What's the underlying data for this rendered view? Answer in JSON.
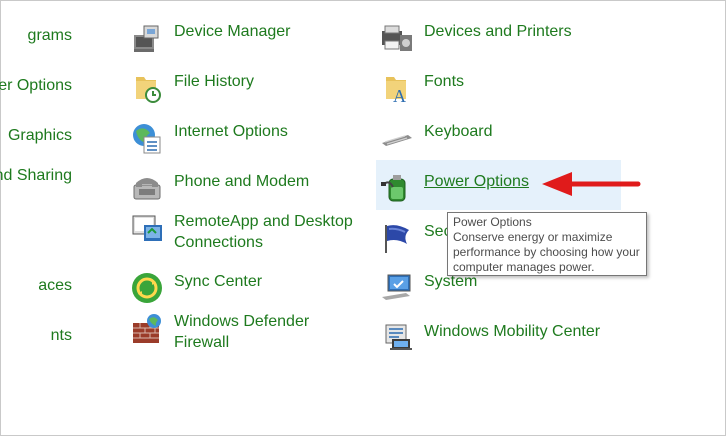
{
  "left_column": [
    "grams",
    "er Options",
    "Graphics",
    "nd Sharing",
    "aces",
    "nts"
  ],
  "col2": [
    "Device Manager",
    "File History",
    "Internet Options",
    "Phone and Modem",
    "RemoteApp and Desktop",
    "Connections",
    "Sync Center",
    "Windows Defender",
    "Firewall"
  ],
  "col3": [
    "Devices and Printers",
    "Fonts",
    "Keyboard",
    "Power Options",
    "Sec",
    "System",
    "Windows Mobility Center"
  ],
  "tooltip": {
    "title": "Power Options",
    "body": "Conserve energy or maximize performance by choosing how your computer manages power."
  },
  "colors": {
    "link": "#1e7a1e",
    "hover_bg": "#e5f1fb",
    "arrow": "#e01b1b"
  },
  "icons": [
    "device-manager-icon",
    "file-history-icon",
    "internet-options-icon",
    "phone-modem-icon",
    "remoteapp-icon",
    "sync-center-icon",
    "defender-firewall-icon",
    "devices-printers-icon",
    "fonts-icon",
    "keyboard-icon",
    "power-options-icon",
    "security-maintenance-icon",
    "system-icon",
    "mobility-center-icon"
  ]
}
